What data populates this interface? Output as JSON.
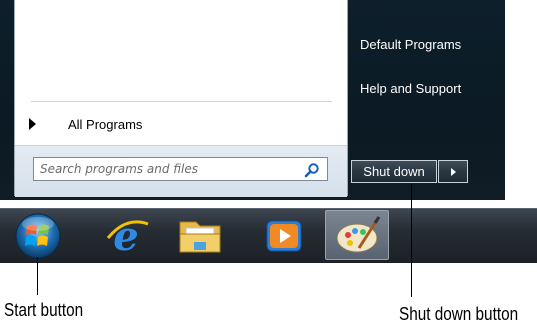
{
  "start_menu": {
    "all_programs_label": "All Programs",
    "search": {
      "placeholder": "Search programs and files",
      "value": ""
    },
    "right_items": [
      "Default Programs",
      "Help and Support"
    ],
    "shut_down_label": "Shut down"
  },
  "taskbar": {
    "icons": [
      "windows-start-orb",
      "internet-explorer",
      "windows-explorer",
      "windows-media-player",
      "paint"
    ]
  },
  "callouts": {
    "start_button": "Start button",
    "shut_down_button": "Shut down button"
  },
  "colors": {
    "menu_dark": "#0d1f2b",
    "taskbar": "#262c33",
    "search_icon": "#1a5fb4"
  }
}
